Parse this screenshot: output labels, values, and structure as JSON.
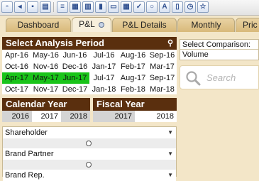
{
  "toolbar": {
    "buttons": [
      "new-file-icon",
      "open-file-icon",
      "save-file-icon",
      "print-icon",
      "list-box-icon",
      "multi-box-icon",
      "table-box-icon",
      "chart-icon",
      "text-box-icon",
      "table-icon",
      "checkbox-icon",
      "search-object-icon",
      "text-icon",
      "bookmark-icon",
      "clock-icon",
      "star-icon"
    ]
  },
  "tabs": [
    {
      "label": "Dashboard"
    },
    {
      "label": "P&L"
    },
    {
      "label": "P&L Details"
    },
    {
      "label": "Monthly"
    },
    {
      "label": "Pric"
    }
  ],
  "analysis": {
    "title": "Select Analysis Period",
    "rows": [
      [
        "Apr-16",
        "May-16",
        "Jun-16",
        "Jul-16",
        "Aug-16",
        "Sep-16"
      ],
      [
        "Oct-16",
        "Nov-16",
        "Dec-16",
        "Jan-17",
        "Feb-17",
        "Mar-17"
      ],
      [
        "Apr-17",
        "May-17",
        "Jun-17",
        "Jul-17",
        "Aug-17",
        "Sep-17"
      ],
      [
        "Oct-17",
        "Nov-17",
        "Dec-17",
        "Jan-18",
        "Feb-18",
        "Mar-18"
      ]
    ],
    "selected": [
      "Apr-17",
      "May-17",
      "Jun-17"
    ],
    "selected_color": "#19c419"
  },
  "calendar_year": {
    "title": "Calendar Year",
    "years": [
      "2016",
      "2017",
      "2018"
    ],
    "selected": "2017"
  },
  "fiscal_year": {
    "title": "Fiscal Year",
    "years": [
      "2017",
      "2018"
    ],
    "selected": "2018"
  },
  "filters": [
    {
      "label": "Shareholder"
    },
    {
      "label": "Brand Partner"
    },
    {
      "label": "Brand Rep."
    }
  ],
  "comparison": {
    "label": "Select Comparison:",
    "value": "Volume"
  },
  "search": {
    "placeholder": "Search"
  },
  "colors": {
    "header_bg": "#5a2f0e",
    "page_bg": "#f3e6c8"
  }
}
